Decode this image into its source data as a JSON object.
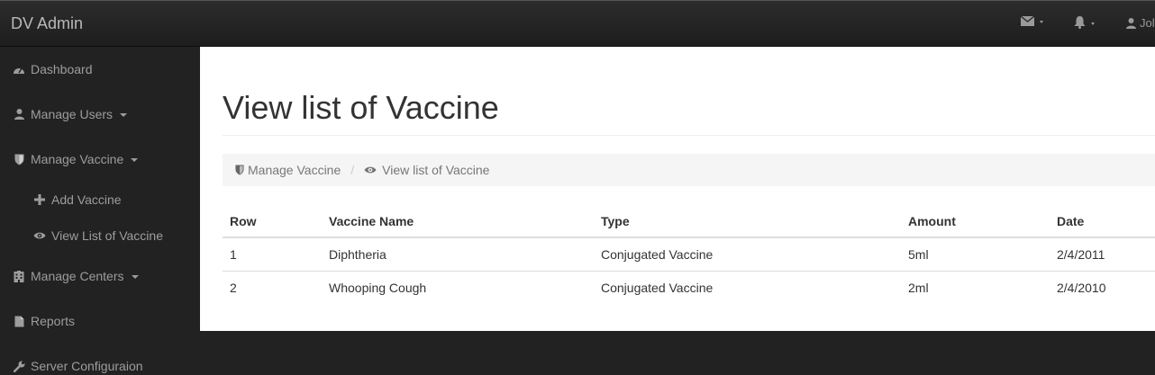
{
  "brand": "DV Admin",
  "topbar": {
    "user_label": "Jol"
  },
  "sidebar": {
    "items": [
      {
        "label": "Dashboard",
        "icon": "dashboard-icon"
      },
      {
        "label": "Manage Users",
        "icon": "user-icon"
      },
      {
        "label": "Manage Vaccine",
        "icon": "shield-icon"
      },
      {
        "label": "Add Vaccine",
        "icon": "plus-icon"
      },
      {
        "label": "View List of Vaccine",
        "icon": "eye-icon"
      },
      {
        "label": "Manage Centers",
        "icon": "hospital-icon"
      },
      {
        "label": "Reports",
        "icon": "file-icon"
      },
      {
        "label": "Server Configuraion",
        "icon": "wrench-icon"
      }
    ]
  },
  "page": {
    "title": "View list of Vaccine"
  },
  "breadcrumb": {
    "parent": "Manage Vaccine",
    "current": "View list of Vaccine"
  },
  "table": {
    "headers": [
      "Row",
      "Vaccine Name",
      "Type",
      "Amount",
      "Date"
    ],
    "rows": [
      [
        "1",
        "Diphtheria",
        "Conjugated Vaccine",
        "5ml",
        "2/4/2011"
      ],
      [
        "2",
        "Whooping Cough",
        "Conjugated Vaccine",
        "2ml",
        "2/4/2010"
      ]
    ]
  },
  "colors": {
    "topbar": "#222222",
    "sidebar_text": "#9d9d9d",
    "content_bg": "#ffffff",
    "breadcrumb_bg": "#f5f5f5"
  }
}
